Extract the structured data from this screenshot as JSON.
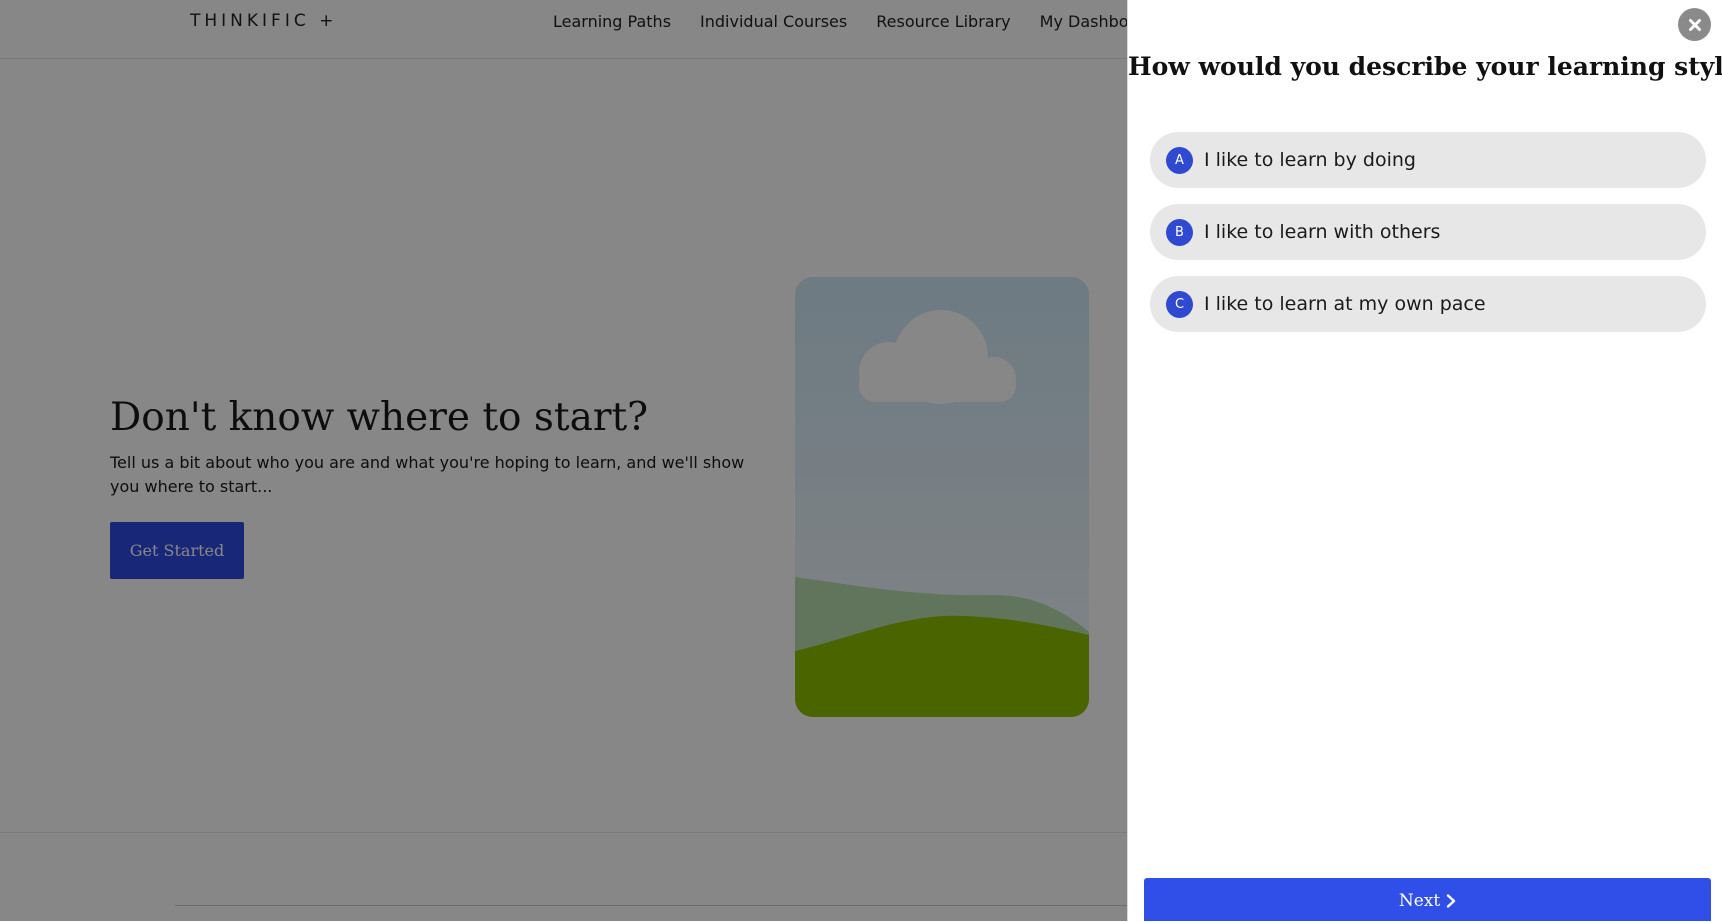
{
  "header": {
    "logo_text": "THINKIFIC +",
    "nav": [
      "Learning Paths",
      "Individual Courses",
      "Resource Library",
      "My Dashboard"
    ]
  },
  "hero": {
    "title": "Don't know where to start?",
    "subtitle": "Tell us a bit about who you are and what you're hoping to learn, and we'll show you where to start...",
    "cta_label": "Get Started"
  },
  "quiz": {
    "question": "How would you describe your learning style?",
    "options": [
      {
        "letter": "A",
        "label": "I like to learn by doing"
      },
      {
        "letter": "B",
        "label": "I like to learn with others"
      },
      {
        "letter": "C",
        "label": "I like to learn at my own pace"
      }
    ],
    "next_label": "Next",
    "close_icon": "close-icon",
    "next_icon": "chevron-right-icon"
  },
  "colors": {
    "accent": "#2f4be0",
    "overlay": "rgba(0,0,0,0.47)",
    "option_bg": "#e7e7e7",
    "close_bg": "#8a8a8a"
  }
}
